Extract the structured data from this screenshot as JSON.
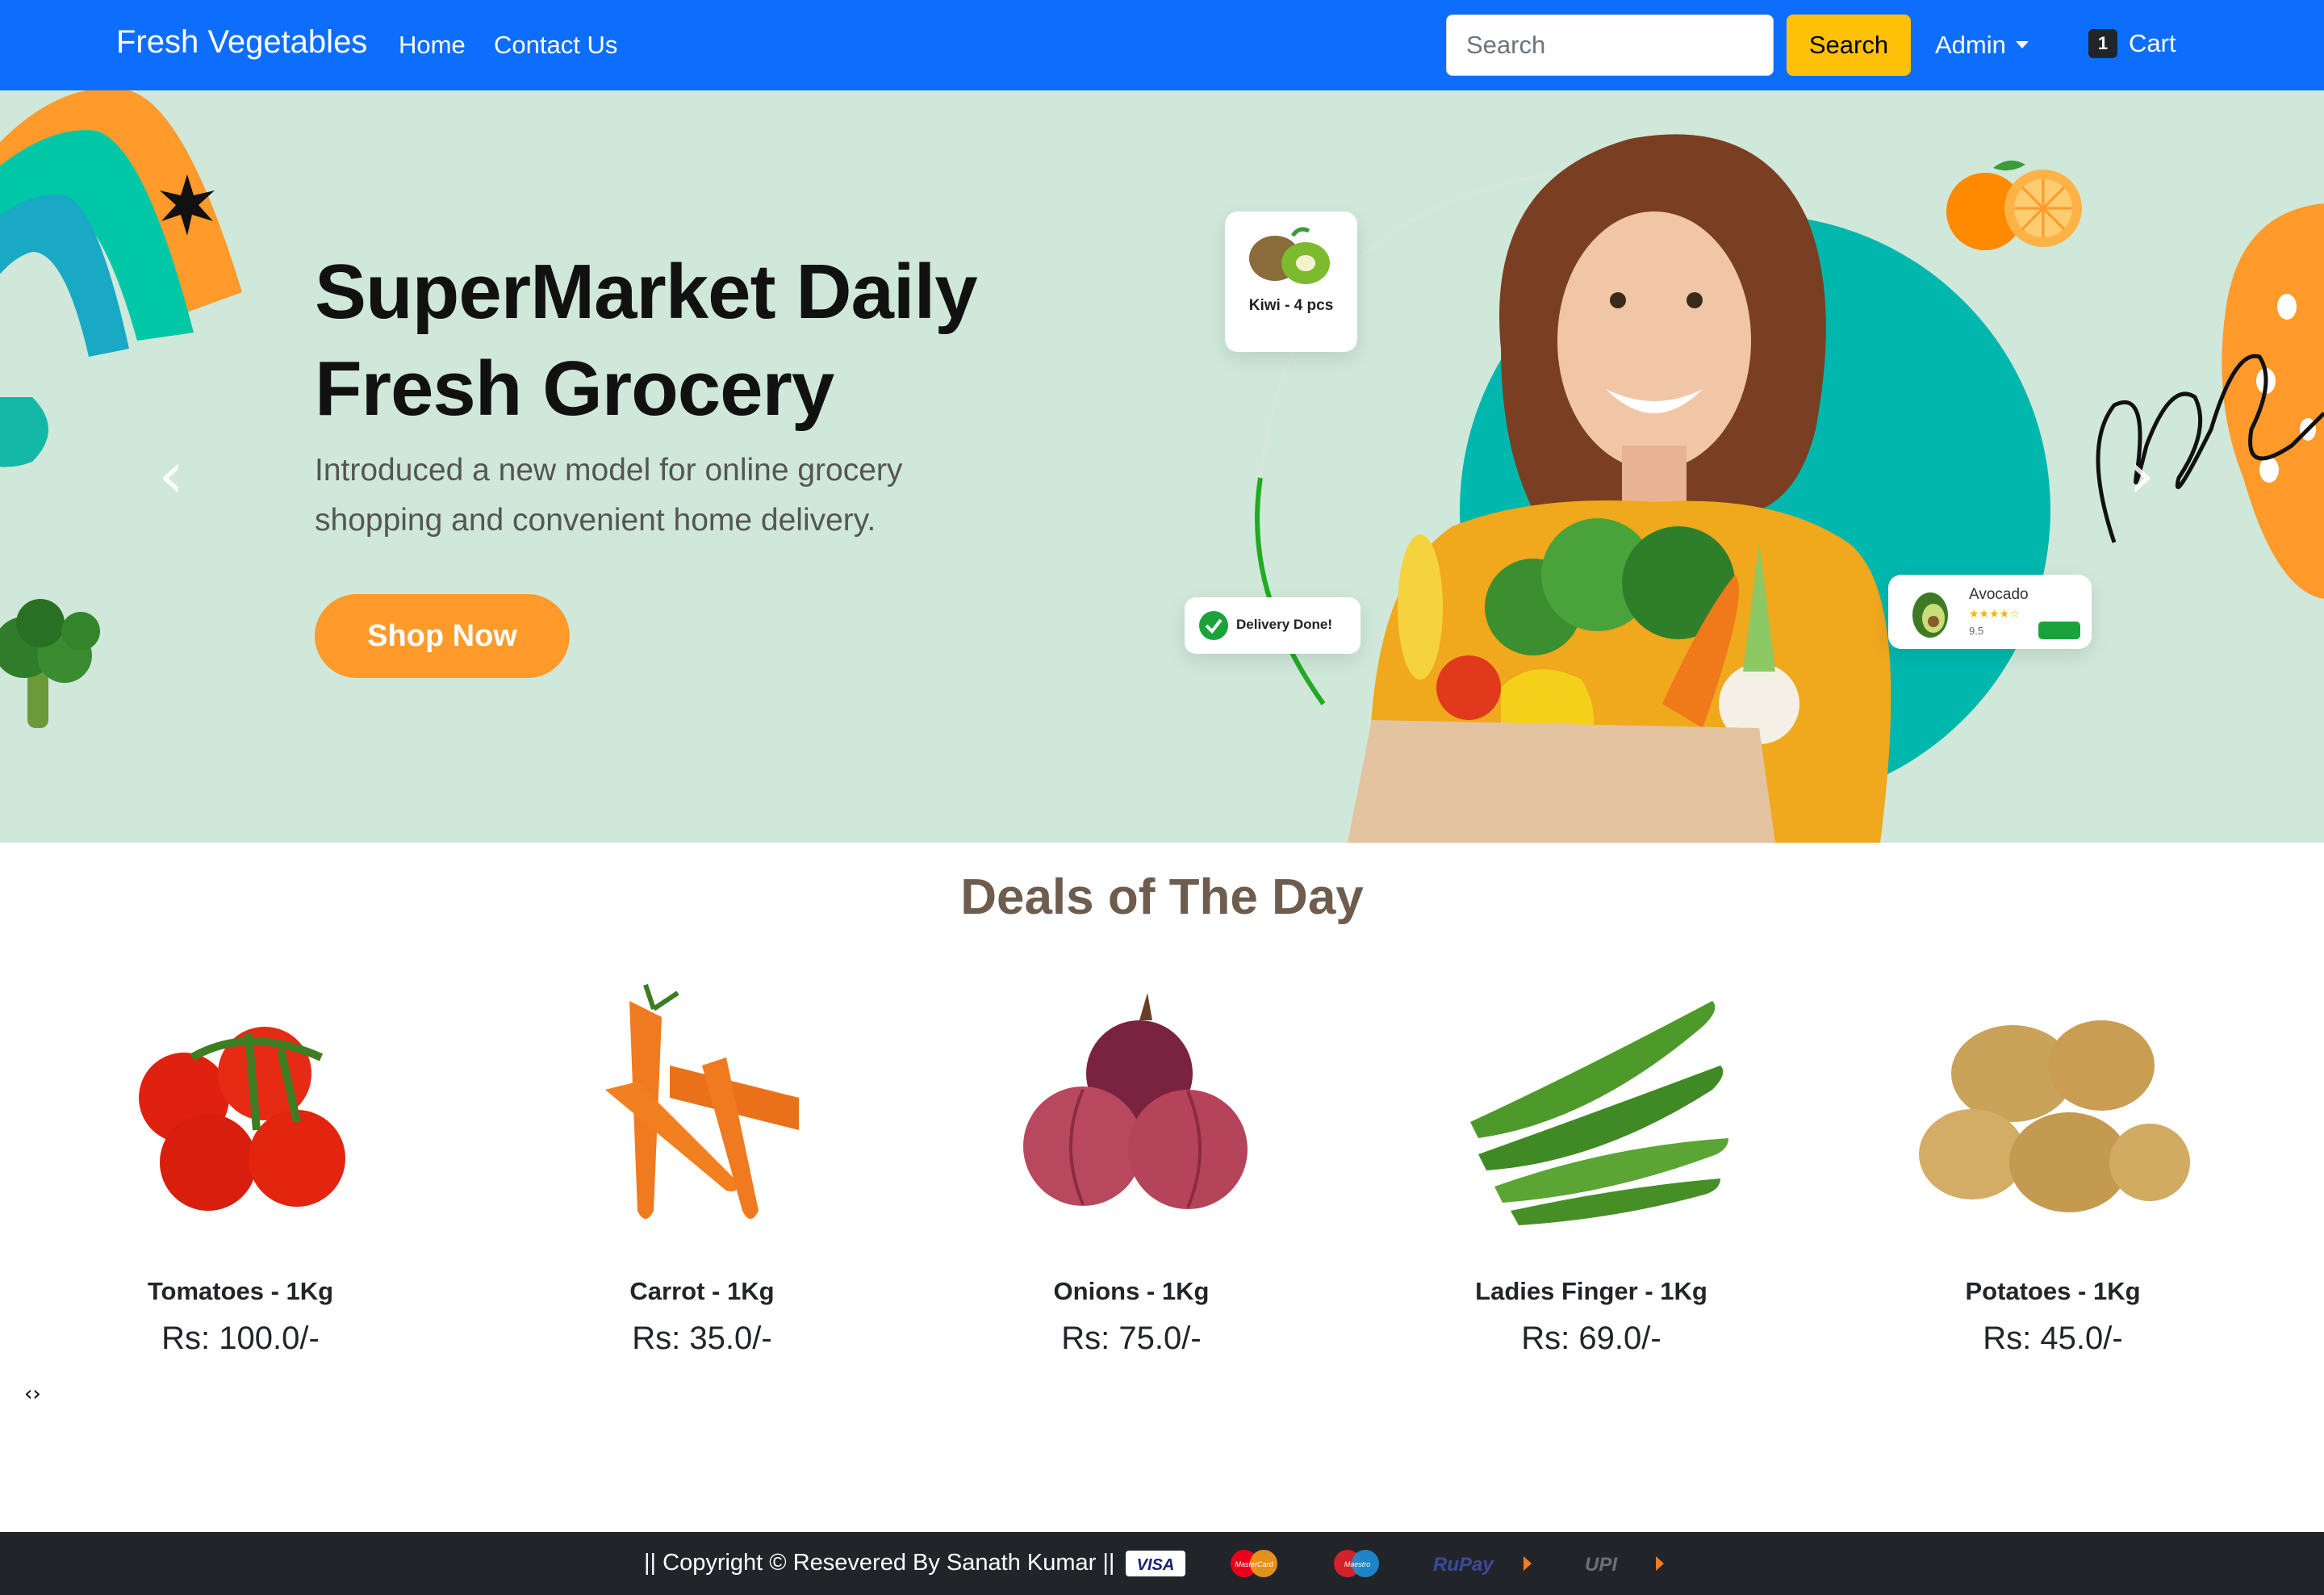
{
  "navbar": {
    "brand": "Fresh Vegetables",
    "links": [
      "Home",
      "Contact Us"
    ],
    "search_placeholder": "Search",
    "search_button": "Search",
    "admin_label": "Admin",
    "cart_count": "1",
    "cart_label": "Cart"
  },
  "hero": {
    "title_line1": "SuperMarket Daily",
    "title_line2": "Fresh Grocery",
    "subtitle_line1": "Introduced a new model for online grocery",
    "subtitle_line2": "shopping and convenient home delivery.",
    "cta": "Shop Now",
    "prev_glyph": "‹",
    "next_glyph": "›",
    "kiwi_card": {
      "name": "Kiwi - 4 pcs"
    },
    "delivery_card": {
      "text": "Delivery Done!"
    },
    "avocado_card": {
      "name": "Avocado",
      "price": "9.5"
    }
  },
  "deals": {
    "title": "Deals of The Day",
    "products": [
      {
        "name": "Tomatoes - 1Kg",
        "price": "Rs: 100.0/-"
      },
      {
        "name": "Carrot - 1Kg",
        "price": "Rs: 35.0/-"
      },
      {
        "name": "Onions - 1Kg",
        "price": "Rs: 75.0/-"
      },
      {
        "name": "Ladies Finger - 1Kg",
        "price": "Rs: 69.0/-"
      },
      {
        "name": "Potatoes - 1Kg",
        "price": "Rs: 45.0/-"
      }
    ],
    "nav": "‹›"
  },
  "footer": {
    "copyright": "|| Copyright © Resevered By Sanath Kumar ||",
    "payments": [
      "VISA",
      "MasterCard",
      "Maestro",
      "RuPay",
      "UPI"
    ]
  },
  "colors": {
    "primary": "#0d6efd",
    "warning": "#ffc107",
    "hero_bg": "#cfe8d9",
    "cta": "#ff9a2b",
    "footer_bg": "#212529"
  }
}
